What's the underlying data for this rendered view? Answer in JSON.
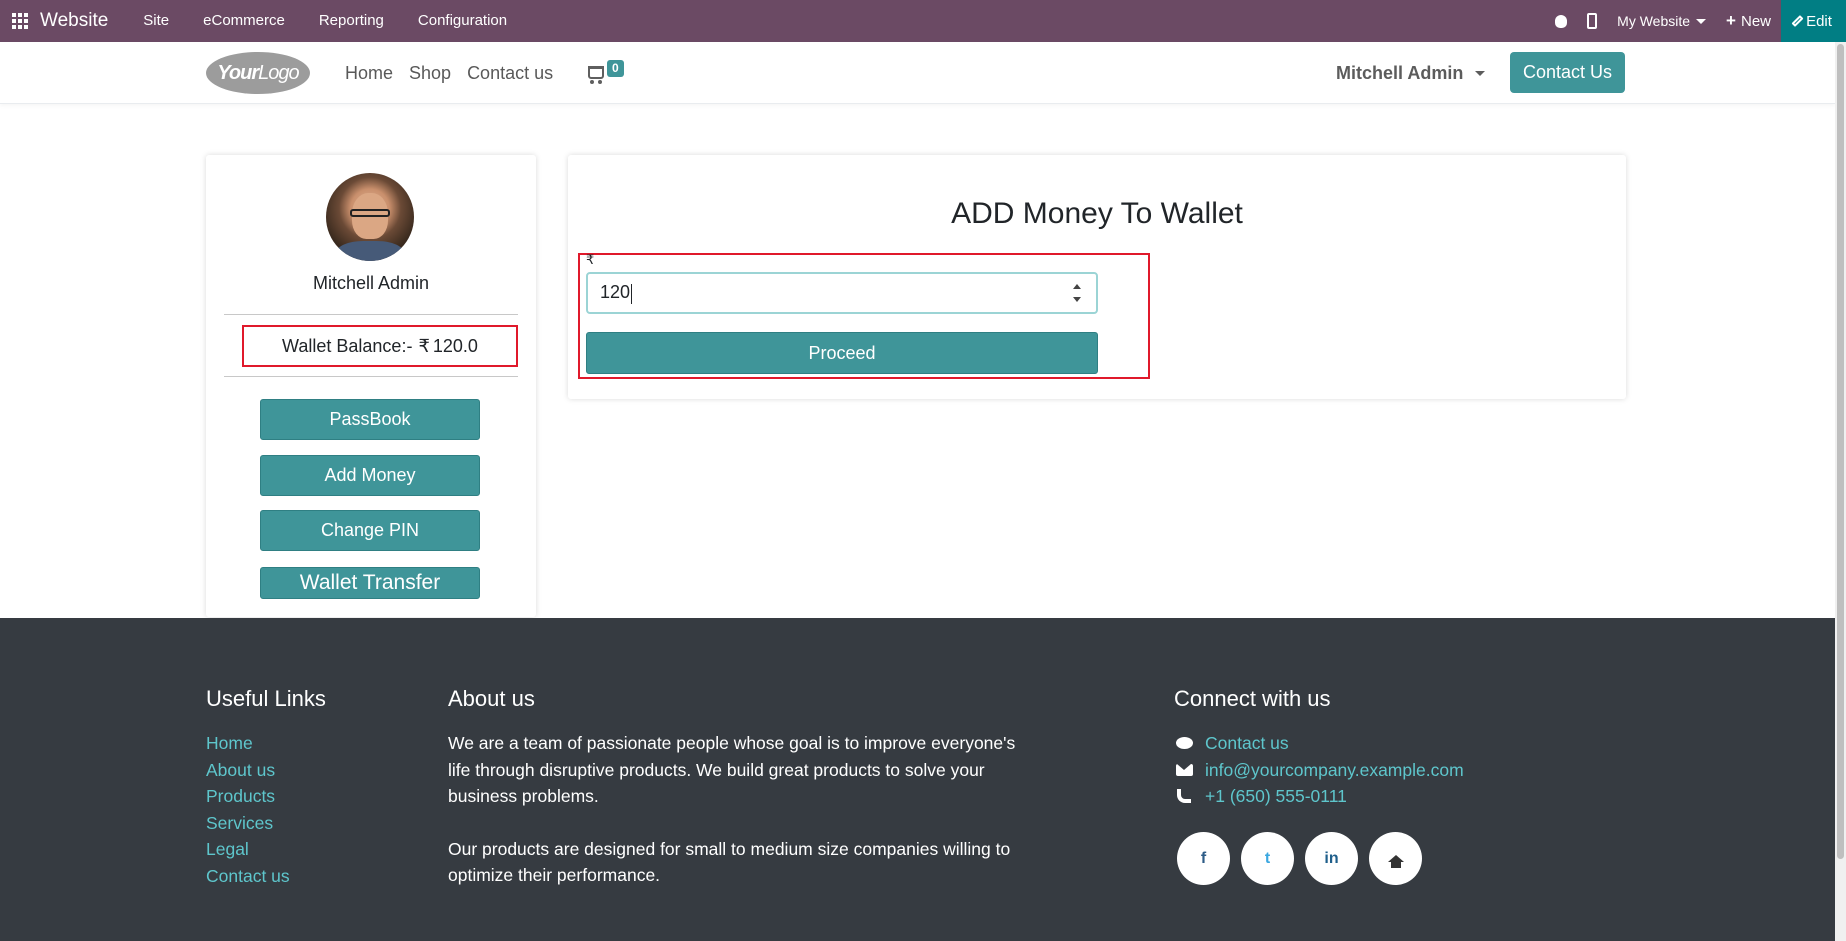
{
  "topbar": {
    "app_name": "Website",
    "menu": [
      "Site",
      "eCommerce",
      "Reporting",
      "Configuration"
    ],
    "website_selector": "My Website",
    "new_label": "New",
    "edit_label": "Edit",
    "bg_color": "#6b4a64"
  },
  "header": {
    "logo_text_bold": "Your",
    "logo_text": "Logo",
    "nav": [
      "Home",
      "Shop",
      "Contact us"
    ],
    "cart_count": "0",
    "user_name": "Mitchell Admin",
    "contact_button": "Contact Us"
  },
  "profile": {
    "name": "Mitchell Admin",
    "balance_label": "Wallet Balance:-",
    "currency": "₹",
    "balance_value": "120.0",
    "buttons": [
      "PassBook",
      "Add Money",
      "Change PIN",
      "Wallet Transfer"
    ]
  },
  "add_money": {
    "title": "ADD Money To Wallet",
    "currency": "₹",
    "amount": "120",
    "proceed_label": "Proceed"
  },
  "footer": {
    "useful_links_title": "Useful Links",
    "useful_links": [
      "Home",
      "About us",
      "Products",
      "Services",
      "Legal",
      "Contact us"
    ],
    "about_title": "About us",
    "about_p1": "We are a team of passionate people whose goal is to improve everyone's life through disruptive products. We build great products to solve your business problems.",
    "about_p2": "Our products are designed for small to medium size companies willing to optimize their performance.",
    "connect_title": "Connect with us",
    "contact_link": "Contact us",
    "email": "info@yourcompany.example.com",
    "phone": "+1 (650) 555-0111",
    "social": {
      "facebook": "f",
      "twitter": "t",
      "linkedin": "in"
    }
  },
  "colors": {
    "accent": "#3f9599",
    "link": "#5ec6cc",
    "highlight": "#e0192b",
    "footer_bg": "#363b41"
  }
}
